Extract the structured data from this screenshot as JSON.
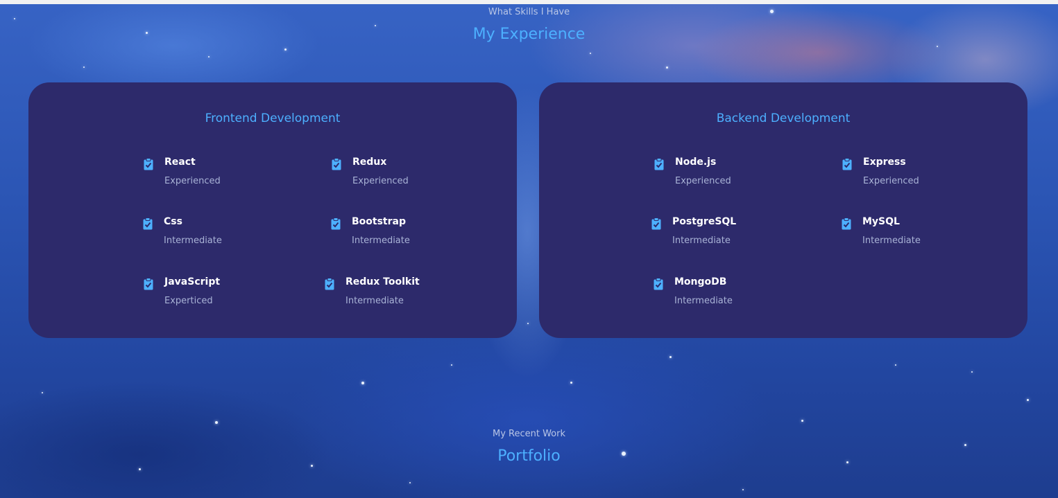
{
  "colors": {
    "accent": "#4db0ff",
    "card_bg": "#2d2a6b",
    "skill_name": "#ffffff",
    "skill_level": "#a9b3d6"
  },
  "experience": {
    "subtitle": "What Skills I Have",
    "title": "My Experience"
  },
  "frontend": {
    "title": "Frontend Development",
    "skills": [
      {
        "name": "React",
        "level": "Experienced",
        "icon": "clipboard-check-icon"
      },
      {
        "name": "Redux",
        "level": "Experienced",
        "icon": "clipboard-check-icon"
      },
      {
        "name": "Css",
        "level": "Intermediate",
        "icon": "clipboard-check-icon"
      },
      {
        "name": "Bootstrap",
        "level": "Intermediate",
        "icon": "clipboard-check-icon"
      },
      {
        "name": "JavaScript",
        "level": "Experticed",
        "icon": "clipboard-check-icon"
      },
      {
        "name": "Redux Toolkit",
        "level": "Intermediate",
        "icon": "clipboard-check-icon"
      }
    ]
  },
  "backend": {
    "title": "Backend Development",
    "skills": [
      {
        "name": "Node.js",
        "level": "Experienced",
        "icon": "clipboard-check-icon"
      },
      {
        "name": "Express",
        "level": "Experienced",
        "icon": "clipboard-check-icon"
      },
      {
        "name": "PostgreSQL",
        "level": "Intermediate",
        "icon": "clipboard-check-icon"
      },
      {
        "name": "MySQL",
        "level": "Intermediate",
        "icon": "clipboard-check-icon"
      },
      {
        "name": "MongoDB",
        "level": "Intermediate",
        "icon": "clipboard-check-icon"
      }
    ]
  },
  "portfolio": {
    "subtitle": "My Recent Work",
    "title": "Portfolio"
  }
}
